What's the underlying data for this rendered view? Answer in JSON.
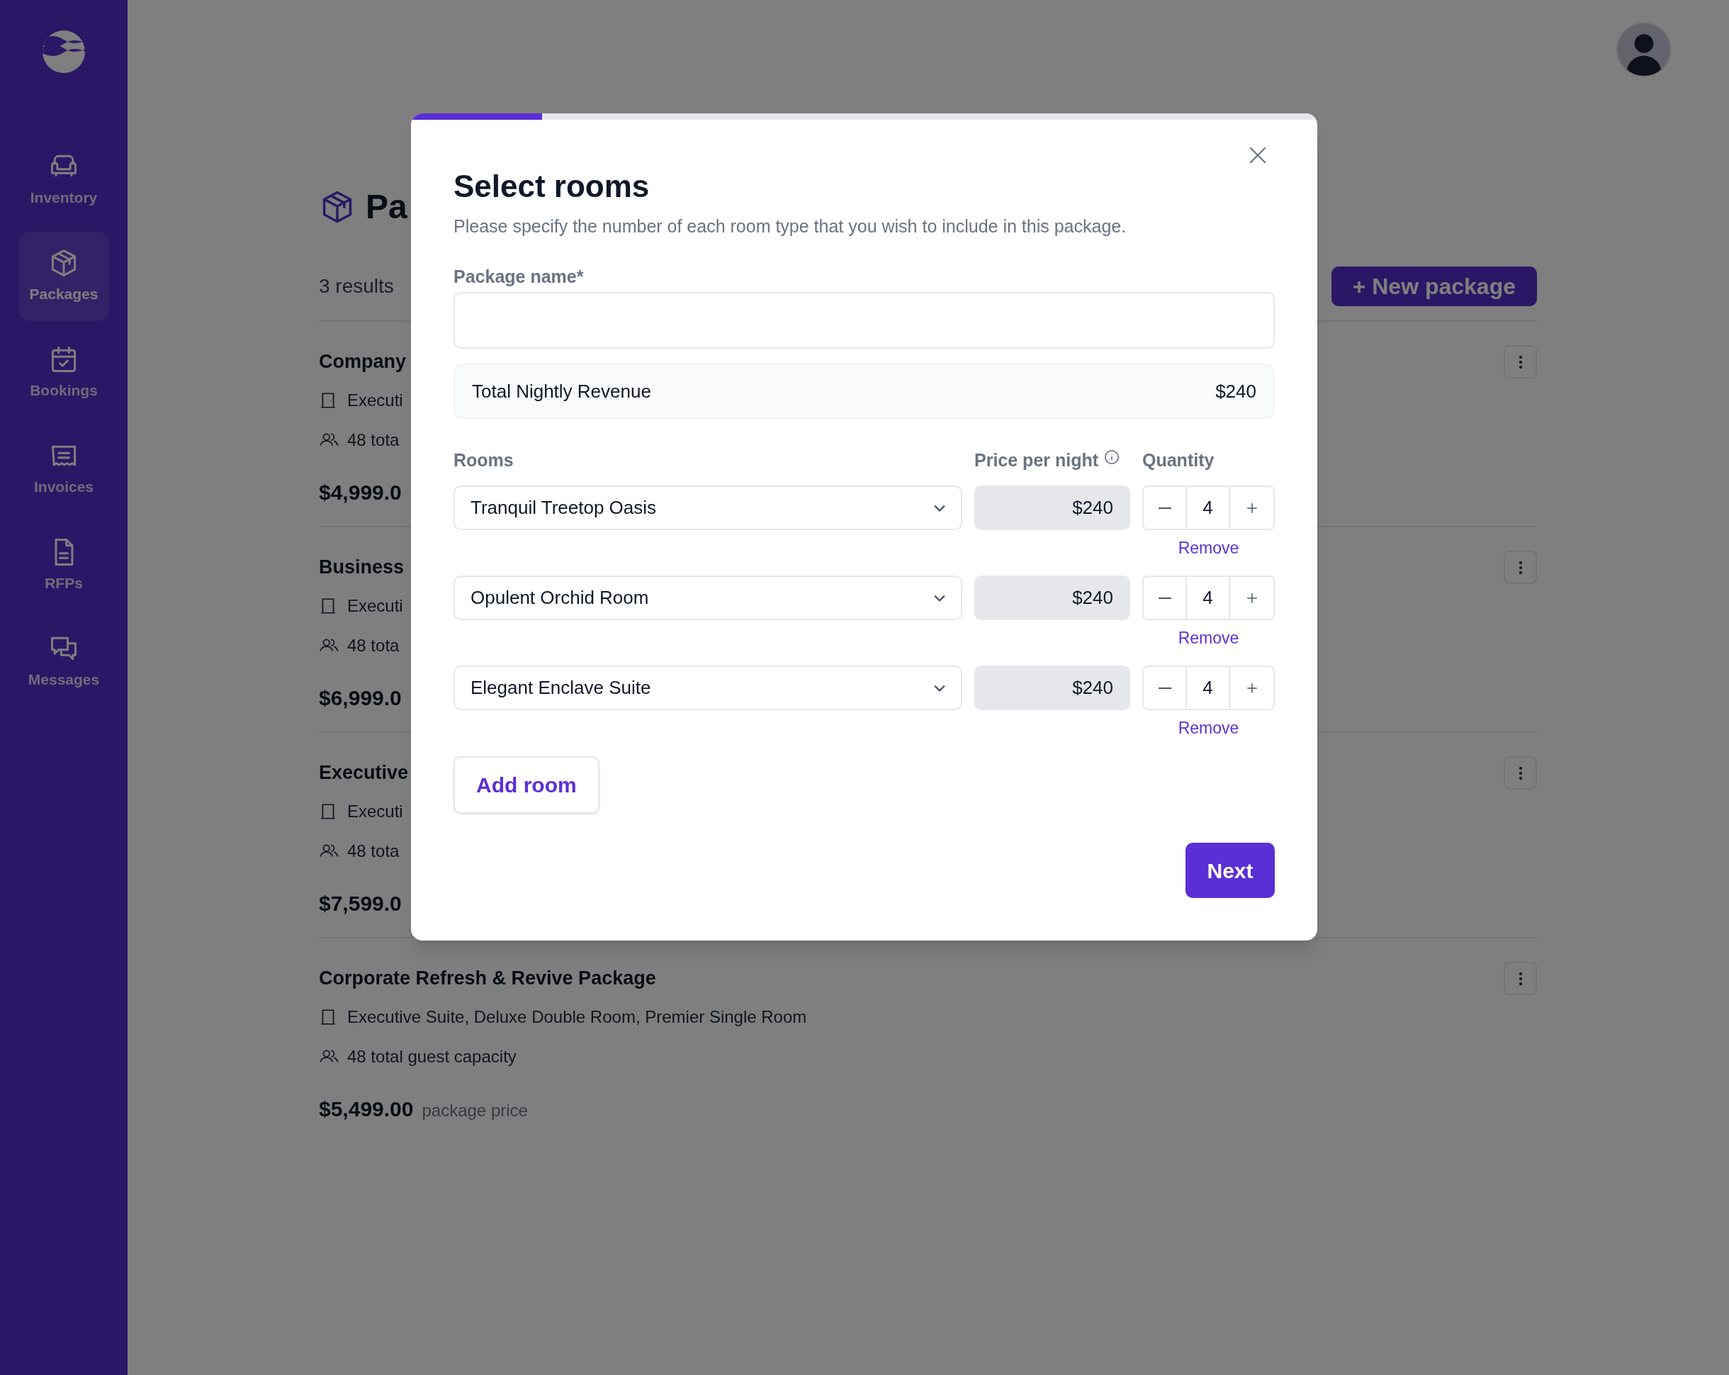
{
  "sidebar": {
    "items": [
      {
        "label": "Inventory",
        "kind": "sofa",
        "selected": false
      },
      {
        "label": "Packages",
        "kind": "box",
        "selected": true
      },
      {
        "label": "Bookings",
        "kind": "calendar",
        "selected": false
      },
      {
        "label": "Invoices",
        "kind": "receipt",
        "selected": false
      },
      {
        "label": "RFPs",
        "kind": "document",
        "selected": false
      },
      {
        "label": "Messages",
        "kind": "chat",
        "selected": false
      }
    ]
  },
  "page": {
    "title": "Pa",
    "results": "3 results",
    "new_button": "+ New package",
    "packages": [
      {
        "title": "Company",
        "rooms": "Executi",
        "capacity": "48 tota",
        "price": "$4,999.0"
      },
      {
        "title": "Business",
        "rooms": "Executi",
        "capacity": "48 tota",
        "price": "$6,999.0"
      },
      {
        "title": "Executive",
        "rooms": "Executi",
        "capacity": "48 tota",
        "price": "$7,599.0"
      },
      {
        "title": "Corporate Refresh & Revive Package",
        "rooms": "Executive Suite, Deluxe Double Room, Premier Single Room",
        "capacity": "48 total guest capacity",
        "price": "$5,499.00",
        "price_note": "package price"
      }
    ]
  },
  "modal": {
    "progress": {
      "level": 0.145
    },
    "title": "Select rooms",
    "subtitle": "Please specify the number of each room type that you wish to include in this package.",
    "name_label": "Package name*",
    "total_label": "Total Nightly Revenue",
    "total_value": "$240",
    "columns": [
      "Rooms",
      "Price per night",
      "Quantity"
    ],
    "rooms": [
      {
        "name": "Tranquil Treetop Oasis",
        "price": "$240",
        "quantity": "4",
        "remove": "Remove"
      },
      {
        "name": "Opulent Orchid Room",
        "price": "$240",
        "quantity": "4",
        "remove": "Remove"
      },
      {
        "name": "Elegant Enclave Suite",
        "price": "$240",
        "quantity": "4",
        "remove": "Remove"
      }
    ],
    "add_button": "Add room",
    "next_button": "Next"
  }
}
